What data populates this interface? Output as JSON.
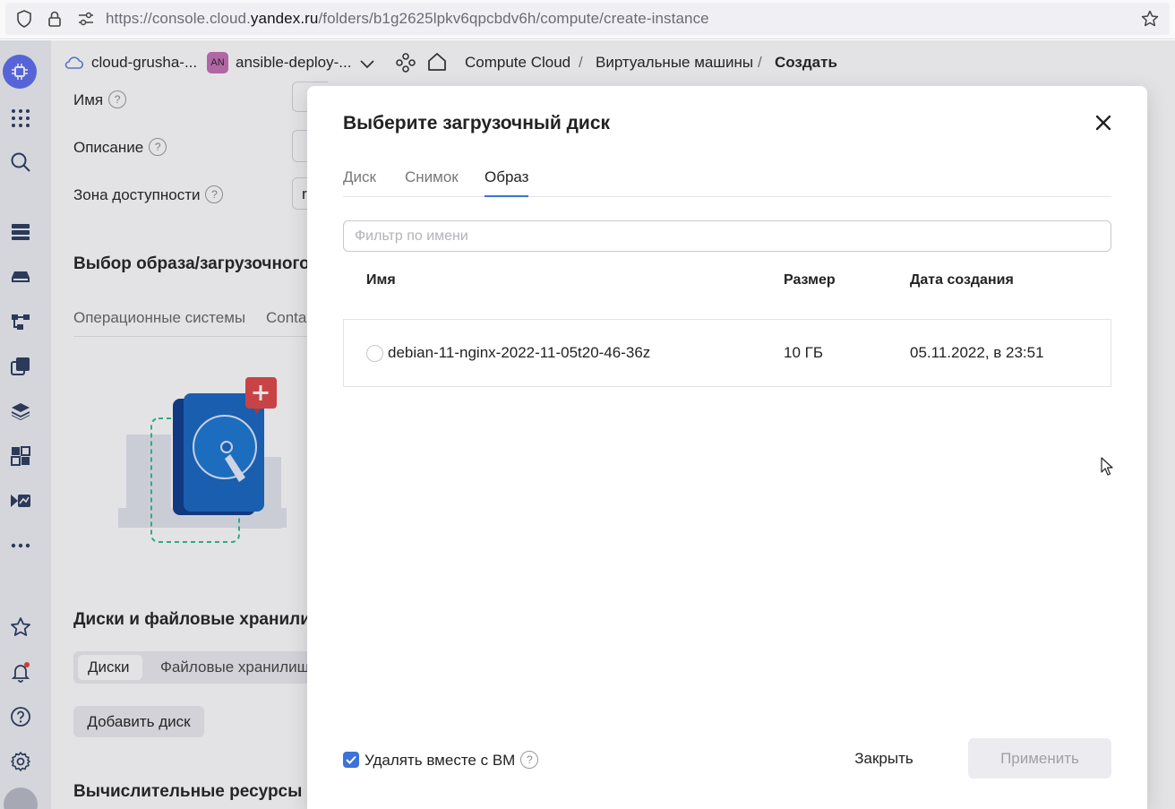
{
  "browser": {
    "url_prefix": "https://console.cloud.",
    "url_domain": "yandex.ru",
    "url_path": "/folders/b1g2625lpkv6qpcbdv6h/compute/create-instance"
  },
  "header": {
    "cloud_name": "cloud-grusha-...",
    "folder_badge": "AN",
    "folder_name": "ansible-deploy-...",
    "breadcrumbs": [
      "Compute Cloud",
      "/",
      "Виртуальные машины",
      "/",
      "Создать"
    ]
  },
  "page": {
    "name_label": "Имя",
    "description_label": "Описание",
    "zone_label": "Зона доступности",
    "zone_value_partial": "r",
    "image_section_title": "Выбор образа/загрузочного д",
    "image_tabs": [
      "Операционные системы",
      "Contai"
    ],
    "disks_section_title": "Диски и файловые хранилищ",
    "disks_tabs": [
      "Диски",
      "Файловые хранилища"
    ],
    "add_disk_button": "Добавить диск",
    "compute_section_title": "Вычислительные ресурсы"
  },
  "modal": {
    "title": "Выберите загрузочный диск",
    "tabs": [
      "Диск",
      "Снимок",
      "Образ"
    ],
    "active_tab": "Образ",
    "filter_placeholder": "Фильтр по имени",
    "columns": [
      "Имя",
      "Размер",
      "Дата создания"
    ],
    "rows": [
      {
        "name": "debian-11-nginx-2022-11-05t20-46-36z",
        "size": "10 ГБ",
        "created": "05.11.2022, в 23:51"
      }
    ],
    "delete_with_vm_label": "Удалять вместе с ВМ",
    "delete_with_vm_checked": true,
    "close_button": "Закрыть",
    "apply_button": "Применить"
  },
  "colors": {
    "accent": "#3b73d8",
    "logo": "#5b6cf0",
    "illustration_blue": "#1565c0",
    "illustration_red": "#e04545",
    "illustration_dash": "#2cbf8a"
  }
}
